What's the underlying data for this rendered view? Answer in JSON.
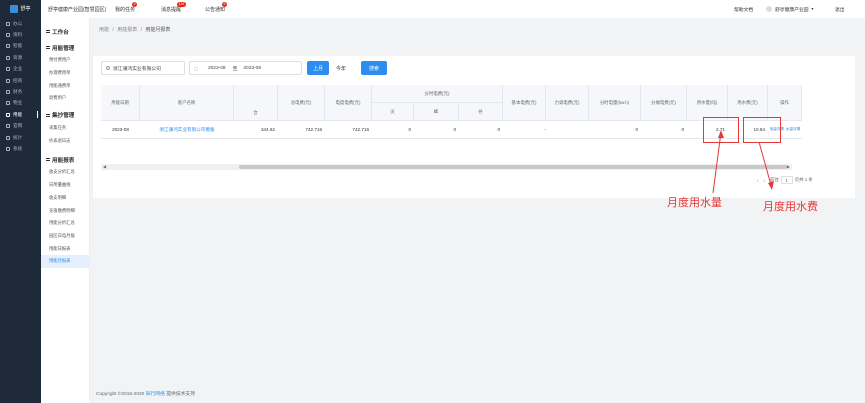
{
  "app": {
    "logo_text": "舒亭",
    "system_title": "舒亭健康产业园(智慧园区)"
  },
  "topnav": [
    {
      "label": "我的任务",
      "badge": "9"
    },
    {
      "label": "消息提醒",
      "badge": "116"
    },
    {
      "label": "公告通知",
      "badge": "9"
    }
  ],
  "top_right": {
    "help": "帮助文档",
    "user": "舒亭健康产业园",
    "logout": "退出"
  },
  "side_nav": [
    {
      "label": "办公",
      "active": false
    },
    {
      "label": "资料",
      "active": false
    },
    {
      "label": "智能",
      "active": false
    },
    {
      "label": "资源",
      "active": false
    },
    {
      "label": "企业",
      "active": false
    },
    {
      "label": "招商",
      "active": false
    },
    {
      "label": "财务",
      "active": false
    },
    {
      "label": "物业",
      "active": false
    },
    {
      "label": "用能",
      "active": true
    },
    {
      "label": "官网",
      "active": false
    },
    {
      "label": "统计",
      "active": false
    },
    {
      "label": "系统",
      "active": false
    }
  ],
  "sub_nav": {
    "workbench": "工作台",
    "group1": {
      "title": "用能管理",
      "items": [
        "预付费用户",
        "办理费用单",
        "用能通费单",
        "退费用户"
      ]
    },
    "group2": {
      "title": "集抄管理",
      "items": [
        "采集任务",
        "抄表退日志"
      ]
    },
    "group3": {
      "title": "用能报表",
      "items": [
        "收支分析汇总",
        "日用量曲线",
        "收支明细",
        "充值缴费明细",
        "用能分析汇总",
        "园区日电月报",
        "用能日报表",
        "用能月报表"
      ],
      "active_index": 7
    }
  },
  "breadcrumb": {
    "items": [
      "用能",
      "用能报表"
    ],
    "current": "用能月报表"
  },
  "filter": {
    "company_placeholder": "浙江谦鸿实业有限公司",
    "date_start": "2023-08",
    "date_sep": "至",
    "date_end": "2023-08",
    "prev_month": "上月",
    "this_year": "今年",
    "search": "搜索"
  },
  "table": {
    "headers": {
      "month": "用能日期",
      "customer": "客户名称",
      "total": "合",
      "elec_fee": "总电费(元)",
      "elec_amount": "电度电费(元)",
      "time_group": "分时电费(元)",
      "peak": "尖",
      "high": "峰",
      "valley": "谷",
      "basic": "基本电费(元)",
      "power_factor": "力调电费(元)",
      "time_kwh": "分时电量(kw.h)",
      "time_fee": "分摊电费(元)",
      "water_amount": "用水量(吨)",
      "water_fee": "用水费(元)",
      "ops": "操作"
    },
    "row": {
      "month": "2023-08",
      "customer": "浙江谦鸿实业有限公司擦备",
      "total": "344.62",
      "elec_fee": "742.716",
      "elec_amount": "742.716",
      "peak": "0",
      "high": "0",
      "valley": "0",
      "basic": "-",
      "power_factor": "",
      "time_kwh": "0",
      "time_fee": "0",
      "water_amount": "2.71",
      "water_fee": "10.84",
      "op1": "电量详情",
      "op2": "水量详情"
    }
  },
  "pager": {
    "goto": "前往",
    "page": "1",
    "total": "页共 1 条"
  },
  "annotations": {
    "water_amount": "月度用水量",
    "water_fee": "月度用水费"
  },
  "footer": {
    "copyright": "Copyright ©2015-2020",
    "brand": "知行网络",
    "support": "提供技术支持"
  }
}
